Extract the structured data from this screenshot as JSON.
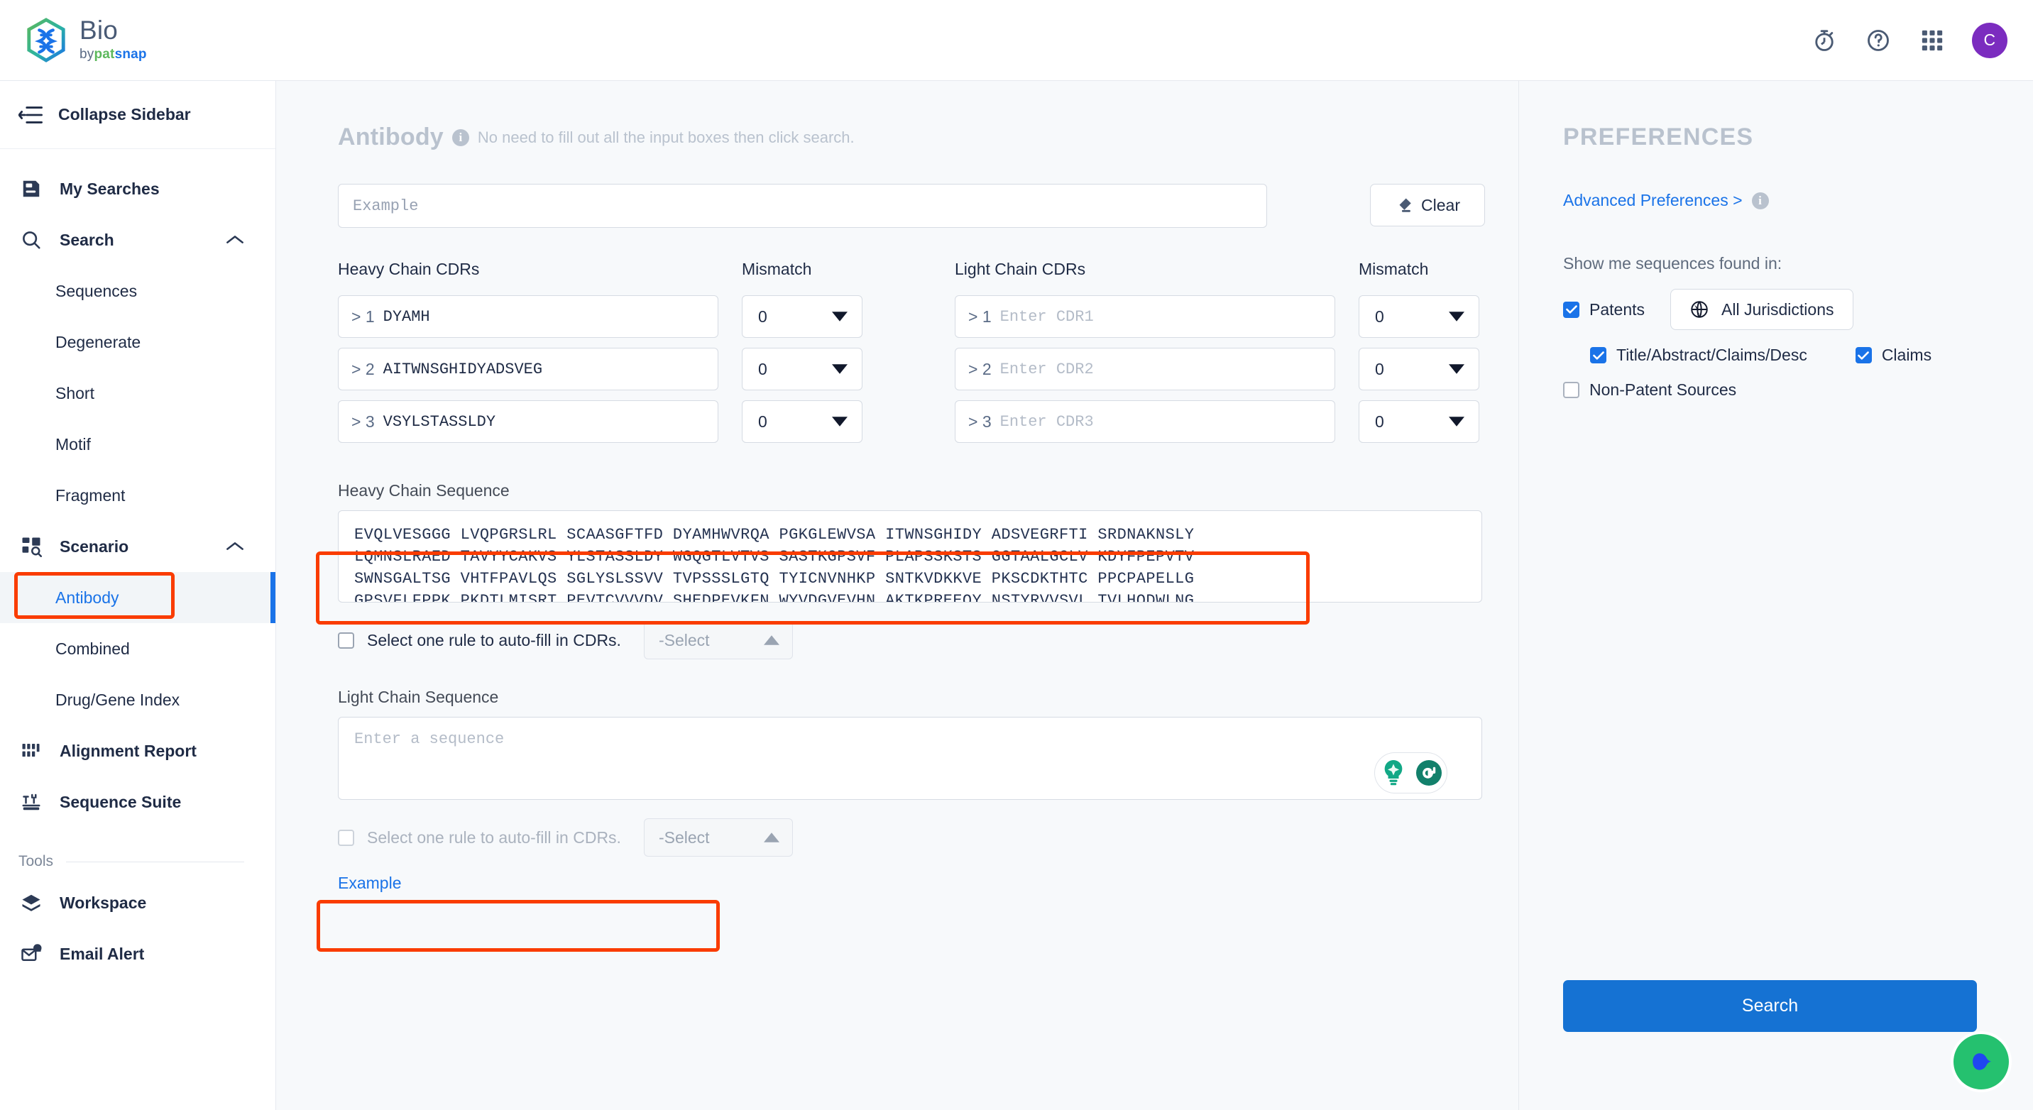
{
  "header": {
    "brand": {
      "title": "Bio",
      "by": "by",
      "pat": "pat",
      "snap": "snap"
    },
    "icons": [
      {
        "name": "stopwatch-icon"
      },
      {
        "name": "help-icon"
      },
      {
        "name": "apps-grid-icon"
      }
    ],
    "avatar_initial": "C"
  },
  "sidebar": {
    "collapse_label": "Collapse Sidebar",
    "items": [
      {
        "label": "My Searches",
        "icon": "saved-searches-icon"
      },
      {
        "label": "Search",
        "icon": "search-icon",
        "expanded": true
      },
      {
        "label": "Scenario",
        "icon": "scenario-icon",
        "expanded": true
      },
      {
        "label": "Alignment Report",
        "icon": "alignment-report-icon"
      },
      {
        "label": "Sequence Suite",
        "icon": "sequence-suite-icon"
      }
    ],
    "search_children": [
      "Sequences",
      "Degenerate",
      "Short",
      "Motif",
      "Fragment"
    ],
    "scenario_children": [
      "Antibody",
      "Combined",
      "Drug/Gene Index"
    ],
    "active_child": "Antibody",
    "tools_label": "Tools",
    "tools_items": [
      {
        "label": "Workspace",
        "icon": "workspace-icon"
      },
      {
        "label": "Email Alert",
        "icon": "email-alert-icon"
      }
    ]
  },
  "main": {
    "page_title": "Antibody",
    "title_hint": "No need to fill out all the input boxes then click search.",
    "example_placeholder": "Example",
    "clear_label": "Clear",
    "heavy_cdr_label": "Heavy Chain CDRs",
    "light_cdr_label": "Light Chain CDRs",
    "mismatch_label": "Mismatch",
    "heavy_cdrs": [
      {
        "index": "> 1",
        "value": "DYAMH",
        "mismatch": "0"
      },
      {
        "index": "> 2",
        "value": "AITWNSGHIDYADSVEG",
        "mismatch": "0"
      },
      {
        "index": "> 3",
        "value": "VSYLSTASSLDY",
        "mismatch": "0"
      }
    ],
    "light_cdrs": [
      {
        "index": "> 1",
        "placeholder": "Enter CDR1",
        "mismatch": "0"
      },
      {
        "index": "> 2",
        "placeholder": "Enter CDR2",
        "mismatch": "0"
      },
      {
        "index": "> 3",
        "placeholder": "Enter CDR3",
        "mismatch": "0"
      }
    ],
    "heavy_seq_label": "Heavy Chain Sequence",
    "heavy_seq_lines": [
      "EVQLVESGGG LVQPGRSLRL SCAASGFTFD DYAMHWVRQA PGKGLEWVSA ITWNSGHIDY ADSVEGRFTI SRDNAKNSLY",
      "LQMNSLRAED TAVYYCAKVS YLSTASSLDY WGQGTLVTVS SASTKGPSVF PLAPSSKSTS GGTAALGCLV KDYFPEPVTV",
      "SWNSGALTSG VHTFPAVLQS SGLYSLSSVV TVPSSSLGTQ TYICNVNHKP SNTKVDKKVE PKSCDKTHTC PPCPAPELLG",
      "GPSVFLFPPK PKDTLMISRT PEVTCVVVDV SHEDPEVKFN WYVDGVEVHN AKTKPREEQY NSTYRVVSVL TVLHQDWLNG"
    ],
    "light_seq_label": "Light Chain Sequence",
    "light_seq_placeholder": "Enter a sequence",
    "rule_heavy": {
      "text": "Select one rule to auto-fill in CDRs.",
      "select_value": "-Select"
    },
    "rule_light": {
      "text": "Select one rule to auto-fill in CDRs.",
      "select_value": "-Select"
    },
    "example_link": "Example"
  },
  "prefs": {
    "title": "PREFERENCES",
    "advanced_link": "Advanced Preferences >",
    "show_label": "Show me sequences found in:",
    "patents_label": "Patents",
    "jurisdictions_label": "All Jurisdictions",
    "title_abstract_label": "Title/Abstract/Claims/Desc",
    "claims_label": "Claims",
    "non_patent_label": "Non-Patent Sources",
    "search_label": "Search"
  },
  "colors": {
    "accent": "#1a73e8",
    "search_button": "#1572d3",
    "annotation": "#fa3c00",
    "avatar": "#7b2cbf"
  }
}
